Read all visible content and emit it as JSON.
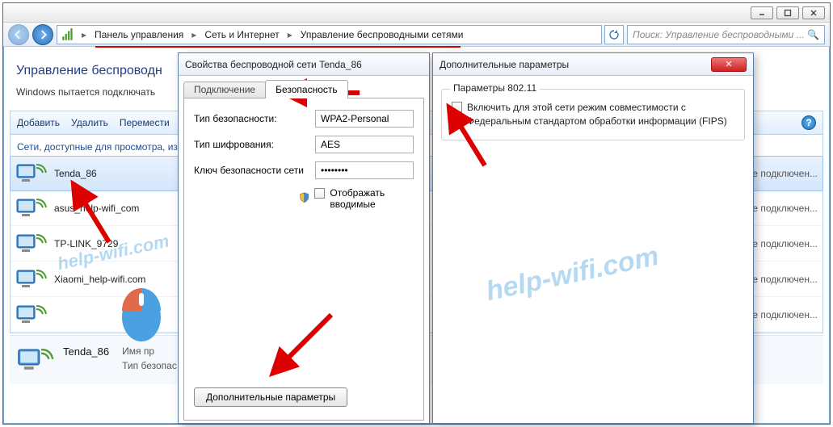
{
  "breadcrumbs": {
    "a": "Панель управления",
    "b": "Сеть и Интернет",
    "c": "Управление беспроводными сетями"
  },
  "search": {
    "placeholder": "Поиск: Управление беспроводными ..."
  },
  "page": {
    "title": "Управление беспроводн",
    "desc": "Windows пытается подключать"
  },
  "toolbar": {
    "add": "Добавить",
    "remove": "Удалить",
    "move": "Перемести"
  },
  "category": "Сети, доступные для просмотра, из",
  "networks": [
    {
      "name": "Tenda_86",
      "status": "е подключен..."
    },
    {
      "name": "asus_help-wifi_com",
      "status": "е подключен..."
    },
    {
      "name": "TP-LINK_9729",
      "status": "е подключен..."
    },
    {
      "name": "Xiaomi_help-wifi.com",
      "status": "е подключен..."
    },
    {
      "name": "",
      "status": "е подключен..."
    }
  ],
  "selected": {
    "name": "Tenda_86",
    "meta1": "Имя пр",
    "meta2": "Тип безопас"
  },
  "dlg1": {
    "title": "Свойства беспроводной сети Tenda_86",
    "tab_conn": "Подключение",
    "tab_sec": "Безопасность",
    "label_sectype": "Тип безопасности:",
    "val_sectype": "WPA2-Personal",
    "label_enc": "Тип шифрования:",
    "val_enc": "AES",
    "label_key": "Ключ безопасности сети",
    "val_key": "••••••••",
    "chk_show": "Отображать вводимые",
    "btn_adv": "Дополнительные параметры"
  },
  "dlg2": {
    "title": "Дополнительные параметры",
    "group": "Параметры 802.11",
    "fips": "Включить для этой сети режим совместимости с Федеральным стандартом обработки информации (FIPS)"
  },
  "watermark": "help-wifi.com"
}
